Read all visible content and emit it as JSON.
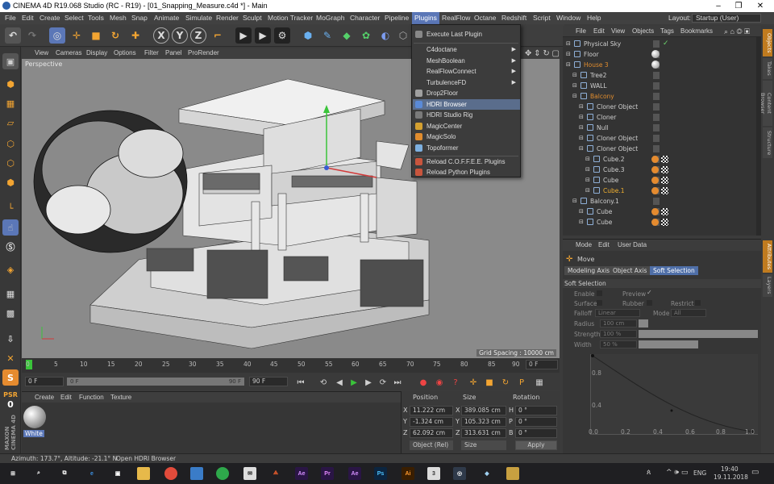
{
  "window": {
    "title": "CINEMA 4D R19.068 Studio (RC - R19) - [01_Snapping_Measure.c4d *] - Main"
  },
  "menubar": {
    "items": [
      "File",
      "Edit",
      "Create",
      "Select",
      "Tools",
      "Mesh",
      "Snap",
      "Animate",
      "Simulate",
      "Render",
      "Sculpt",
      "Motion Tracker",
      "MoGraph",
      "Character",
      "Pipeline",
      "Plugins",
      "RealFlow",
      "Octane",
      "Redshift",
      "Script",
      "Window",
      "Help"
    ],
    "active": "Plugins",
    "layout_label": "Layout:",
    "layout_value": "Startup (User)"
  },
  "toolbar": {
    "axis_x": "X",
    "axis_y": "Y",
    "axis_z": "Z"
  },
  "plugins_menu": {
    "execute_last": "Execute Last Plugin",
    "items": [
      {
        "label": "C4doctane",
        "submenu": true
      },
      {
        "label": "MeshBoolean",
        "submenu": true
      },
      {
        "label": "RealFlowConnect",
        "submenu": true
      },
      {
        "label": "TurbulenceFD",
        "submenu": true
      },
      {
        "label": "Drop2Floor",
        "submenu": false
      },
      {
        "label": "HDRI Browser",
        "submenu": false,
        "highlighted": true
      },
      {
        "label": "HDRI Studio Rig",
        "submenu": false
      },
      {
        "label": "MagicCenter",
        "submenu": false
      },
      {
        "label": "MagicSolo",
        "submenu": false
      },
      {
        "label": "Topoformer",
        "submenu": false
      }
    ],
    "reload_coffee": "Reload C.O.F.F.E.E. Plugins",
    "reload_python": "Reload Python Plugins"
  },
  "viewport": {
    "menu": [
      "View",
      "Cameras",
      "Display",
      "Options",
      "Filter",
      "Panel",
      "ProRender"
    ],
    "label": "Perspective",
    "grid_spacing": "Grid Spacing : 10000 cm"
  },
  "timeline": {
    "ticks": [
      "0",
      "5",
      "10",
      "15",
      "20",
      "25",
      "30",
      "35",
      "40",
      "45",
      "50",
      "55",
      "60",
      "65",
      "70",
      "75",
      "80",
      "85",
      "90"
    ],
    "frame_end_label": "0 F"
  },
  "transport": {
    "start_field": "0 F",
    "min_field": "0 F",
    "max_field": "90 F",
    "end_field": "90 F"
  },
  "material_panel": {
    "menu": [
      "Create",
      "Edit",
      "Function",
      "Texture"
    ],
    "material_name": "White"
  },
  "coordinates": {
    "headers": [
      "Position",
      "Size",
      "Rotation"
    ],
    "rows": [
      {
        "axis": "X",
        "pos": "11.222 cm",
        "saxis": "X",
        "size": "389.085 cm",
        "raxis": "H",
        "rot": "0 °"
      },
      {
        "axis": "Y",
        "pos": "-1.324 cm",
        "saxis": "Y",
        "size": "105.323 cm",
        "raxis": "P",
        "rot": "0 °"
      },
      {
        "axis": "Z",
        "pos": "62.092 cm",
        "saxis": "Z",
        "size": "313.631 cm",
        "raxis": "B",
        "rot": "0 °"
      }
    ],
    "mode_select": "Object (Rel)",
    "size_select": "Size",
    "apply": "Apply"
  },
  "object_manager": {
    "menu": [
      "File",
      "Edit",
      "View",
      "Objects",
      "Tags",
      "Bookmarks"
    ],
    "rows": [
      {
        "name": "Physical Sky",
        "indent": 0,
        "color": "#cfcfcf",
        "check": true
      },
      {
        "name": "Floor",
        "indent": 0,
        "color": "#cfcfcf",
        "sphere": true
      },
      {
        "name": "House 3",
        "indent": 0,
        "color": "#e08c2e",
        "sphere": true
      },
      {
        "name": "Tree2",
        "indent": 1,
        "color": "#cfcfcf"
      },
      {
        "name": "WALL",
        "indent": 1,
        "color": "#cfcfcf"
      },
      {
        "name": "Balcony",
        "indent": 1,
        "color": "#e08c2e"
      },
      {
        "name": "Cloner Object",
        "indent": 2,
        "color": "#cfcfcf"
      },
      {
        "name": "Cloner",
        "indent": 2,
        "color": "#cfcfcf"
      },
      {
        "name": "Null",
        "indent": 2,
        "color": "#cfcfcf"
      },
      {
        "name": "Cloner Object",
        "indent": 2,
        "color": "#cfcfcf"
      },
      {
        "name": "Cloner Object",
        "indent": 2,
        "color": "#cfcfcf"
      },
      {
        "name": "Cube.2",
        "indent": 3,
        "color": "#cfcfcf",
        "tex": true
      },
      {
        "name": "Cube.3",
        "indent": 3,
        "color": "#cfcfcf",
        "tex": true
      },
      {
        "name": "Cube",
        "indent": 3,
        "color": "#cfcfcf",
        "tex": true
      },
      {
        "name": "Cube.1",
        "indent": 3,
        "color": "#f0b030",
        "tex": true
      },
      {
        "name": "Balcony.1",
        "indent": 1,
        "color": "#cfcfcf"
      },
      {
        "name": "Cube",
        "indent": 2,
        "color": "#cfcfcf",
        "tex": true
      },
      {
        "name": "Cube",
        "indent": 2,
        "color": "#cfcfcf",
        "tex": true
      }
    ]
  },
  "attributes": {
    "menu": [
      "Mode",
      "Edit",
      "User Data"
    ],
    "tool_name": "Move",
    "tabs": [
      "Modeling Axis",
      "Object Axis",
      "Soft Selection"
    ],
    "selected_tab": "Soft Selection",
    "section": "Soft Selection",
    "enable": "Enable",
    "preview": "Preview",
    "surface": "Surface",
    "rubber": "Rubber",
    "restrict": "Restrict",
    "falloff": "Falloff",
    "falloff_value": "Linear",
    "mode": "Mode",
    "mode_value": "All",
    "radius": "Radius",
    "radius_value": "100 cm",
    "strength": "Strength",
    "strength_value": "100 %",
    "width": "Width",
    "width_value": "50 %",
    "graph_y": [
      "0.8",
      "0.4"
    ],
    "graph_x": [
      "0.0",
      "0.2",
      "0.4",
      "0.6",
      "0.8",
      "1.0"
    ]
  },
  "side_tabs": [
    "Objects",
    "Takes",
    "Content Browser",
    "Structure",
    "Attributes",
    "Layers"
  ],
  "statusbar": {
    "coords": "Azimuth: 173.7°, Altitude: -21.1°  N",
    "hint": "Open HDRI Browser"
  },
  "taskbar": {
    "lang": "ENG",
    "time": "19:40",
    "date": "19.11.2018"
  },
  "colors": {
    "accent": "#5b77b7",
    "orange": "#e08c2e",
    "viewport": "#8a8a8a"
  }
}
